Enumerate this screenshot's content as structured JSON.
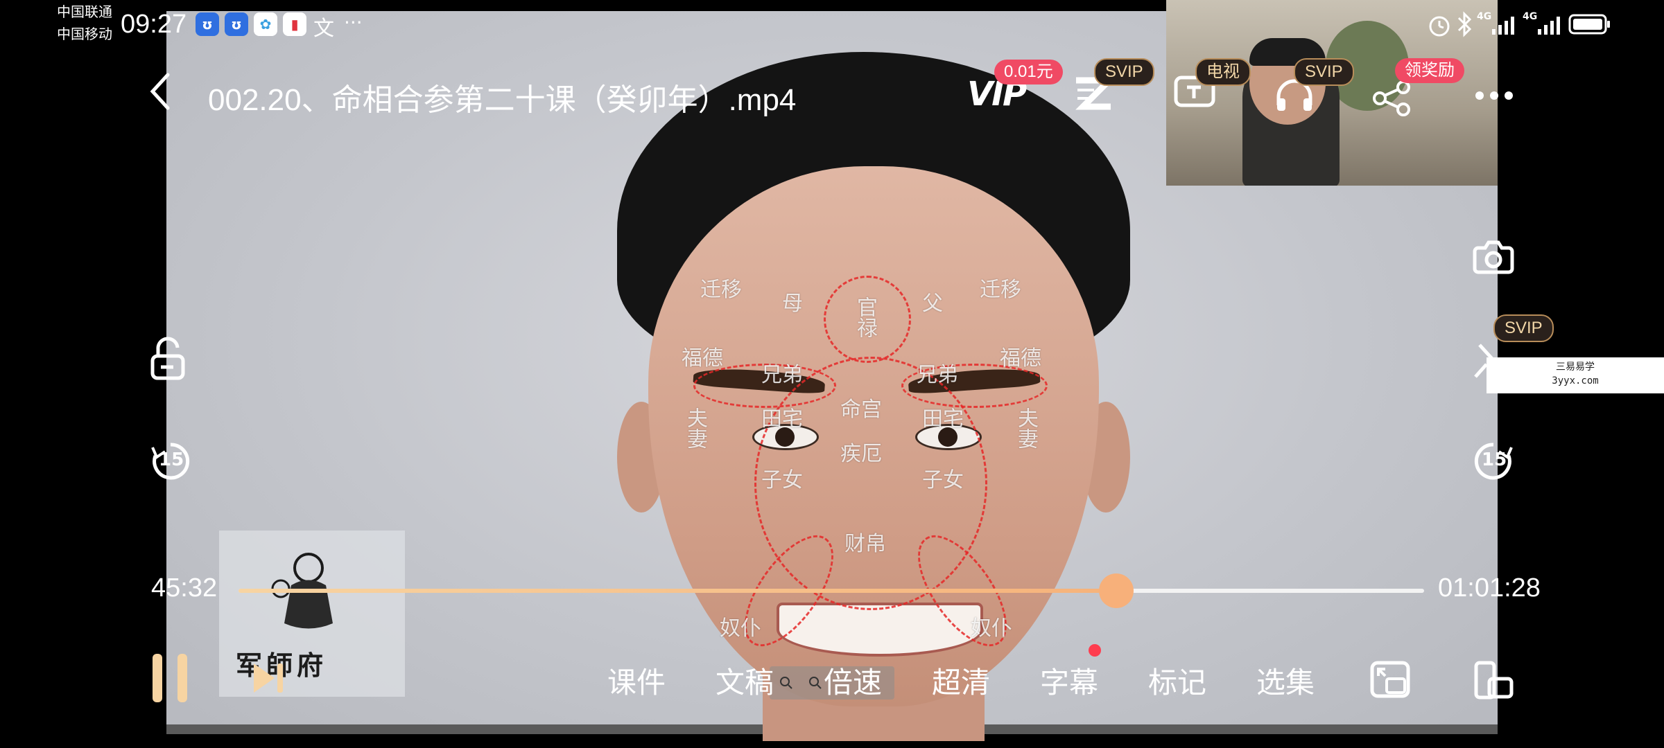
{
  "status_bar": {
    "carrier_1": "中国联通",
    "carrier_2": "中国移动",
    "time": "09:27",
    "more": "···",
    "network_1": "4G",
    "network_2": "4G"
  },
  "top_bar": {
    "title": "002.20、命相合参第二十课（癸卯年）.mp4",
    "vip_price_badge": "0.01元",
    "svip_badge_1": "SVIP",
    "tv_badge": "电视",
    "svip_badge_2": "SVIP",
    "reward_badge": "领奖励"
  },
  "side": {
    "svip_badge": "SVIP",
    "rewind_seconds": "15",
    "forward_seconds": "15"
  },
  "video_content": {
    "labels": {
      "qianyi_left": "迁移",
      "mu": "母",
      "guanlu": "官禄",
      "fu": "父",
      "qianyi_right": "迁移",
      "fude_left": "福德",
      "xiongdi_left": "兄弟",
      "xiongdi_right": "兄弟",
      "fude_right": "福德",
      "fuqi_left": "夫妻",
      "tianzhai_left": "田宅",
      "minggong": "命宫",
      "tianzhai_right": "田宅",
      "fuqi_right": "夫妻",
      "jie": "疾厄",
      "zinv_left": "子女",
      "zinv_right": "子女",
      "caibo": "财帛",
      "nupu_left": "奴仆",
      "nupu_right": "奴仆"
    },
    "watermark_text": "军師府",
    "site_stamp_line1": "三易易学",
    "site_stamp_line2": "3yyx.com"
  },
  "progress": {
    "current_time": "45:32",
    "total_time": "01:01:28",
    "fraction": 0.7405
  },
  "controls": {
    "items": [
      "课件",
      "文稿",
      "倍速",
      "超清",
      "字幕",
      "标记",
      "选集"
    ]
  },
  "colors": {
    "accent_progress": "#f6b27a",
    "badge_red": "#f04a64",
    "svip_gold": "#f2d7a8"
  }
}
